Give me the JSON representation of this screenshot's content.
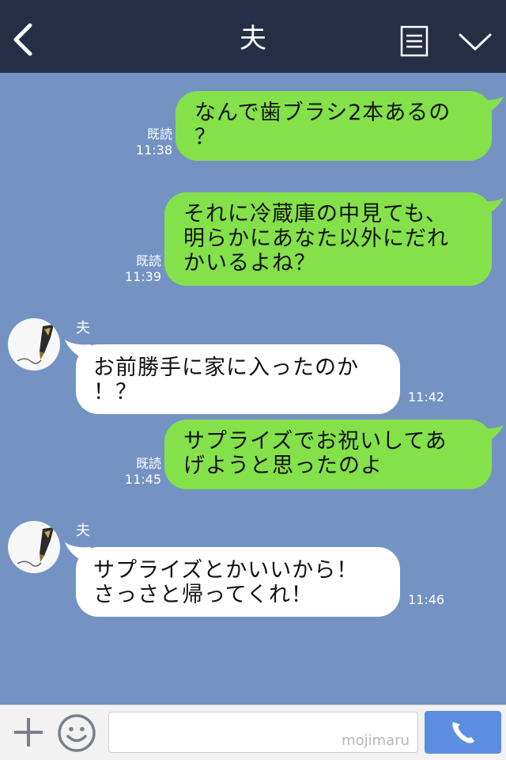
{
  "header": {
    "title": "夫",
    "icons": {
      "back": "chevron-left-icon",
      "menu": "list-icon",
      "collapse": "chevron-down-icon"
    }
  },
  "messages": [
    {
      "side": "out",
      "lines": [
        "なんで歯ブラシ2本あるの",
        "？"
      ],
      "read": "既読",
      "time": "11:38"
    },
    {
      "side": "out",
      "lines": [
        "それに冷蔵庫の中見ても、",
        "明らかにあなた以外にだれ",
        "かいるよね？"
      ],
      "read": "既読",
      "time": "11:39"
    },
    {
      "side": "in",
      "sender": "夫",
      "lines": [
        "お前勝手に家に入ったのか",
        "！？"
      ],
      "time": "11:42"
    },
    {
      "side": "out",
      "lines": [
        "サプライズでお祝いしてあ",
        "げようと思ったのよ"
      ],
      "read": "既読",
      "time": "11:45"
    },
    {
      "side": "in",
      "sender": "夫",
      "lines": [
        "サプライズとかいいから！",
        "さっさと帰ってくれ！"
      ],
      "time": "11:46"
    }
  ],
  "footer": {
    "input_value": "",
    "watermark": "mojimaru",
    "icons": {
      "plus": "plus-icon",
      "emoji": "smiley-icon",
      "call": "phone-icon"
    }
  },
  "colors": {
    "header_bg": "#252e45",
    "chat_bg": "#7493c3",
    "outgoing_bubble": "#84e14a",
    "incoming_bubble": "#ffffff",
    "call_button": "#5b8ee0"
  }
}
